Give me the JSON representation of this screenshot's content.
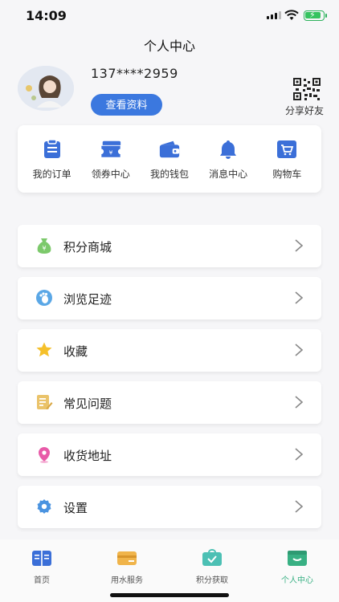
{
  "status_bar": {
    "time": "14:09"
  },
  "header": {
    "title": "个人中心"
  },
  "profile": {
    "phone": "137****2959",
    "view_profile_label": "查看资料",
    "share_label": "分享好友"
  },
  "quick_menu": [
    {
      "label": "我的订单",
      "icon": "order-clipboard-icon"
    },
    {
      "label": "领券中心",
      "icon": "coupon-ticket-icon"
    },
    {
      "label": "我的钱包",
      "icon": "wallet-icon"
    },
    {
      "label": "消息中心",
      "icon": "bell-icon"
    },
    {
      "label": "购物车",
      "icon": "shopping-cart-icon"
    }
  ],
  "menu": [
    {
      "label": "积分商城",
      "icon": "points-bag-icon"
    },
    {
      "label": "浏览足迹",
      "icon": "footprint-icon"
    },
    {
      "label": "收藏",
      "icon": "star-icon"
    },
    {
      "label": "常见问题",
      "icon": "faq-edit-icon"
    },
    {
      "label": "收货地址",
      "icon": "location-pin-icon"
    },
    {
      "label": "设置",
      "icon": "settings-gear-icon"
    }
  ],
  "tab_bar": [
    {
      "label": "首页",
      "icon": "home-book-icon",
      "active": false
    },
    {
      "label": "用水服务",
      "icon": "water-service-card-icon",
      "active": false
    },
    {
      "label": "积分获取",
      "icon": "points-check-icon",
      "active": false
    },
    {
      "label": "个人中心",
      "icon": "profile-box-icon",
      "active": true
    }
  ],
  "colors": {
    "accent_blue": "#3b78df",
    "active_tab_green": "#38b083",
    "background": "#f6f6f8"
  }
}
